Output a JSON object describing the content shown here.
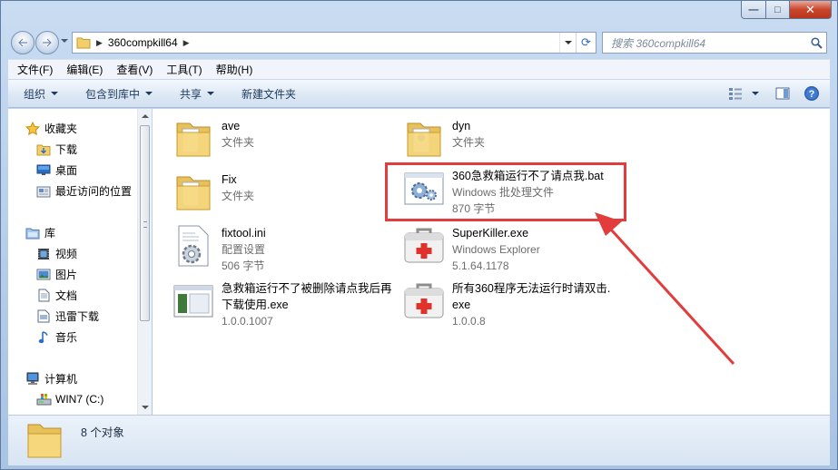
{
  "window": {
    "caption_buttons": {
      "minimize": "—",
      "maximize": "□",
      "close": "✕"
    }
  },
  "address": {
    "path_segment": "360compkill64",
    "search_placeholder": "搜索 360compkill64"
  },
  "menubar": {
    "items": [
      "文件(F)",
      "编辑(E)",
      "查看(V)",
      "工具(T)",
      "帮助(H)"
    ]
  },
  "toolbar": {
    "organize": "组织",
    "include_in_library": "包含到库中",
    "share": "共享",
    "new_folder": "新建文件夹"
  },
  "sidebar": {
    "favorites": {
      "label": "收藏夹",
      "items": [
        "下载",
        "桌面",
        "最近访问的位置"
      ]
    },
    "libraries": {
      "label": "库",
      "items": [
        "视频",
        "图片",
        "文档",
        "迅雷下载",
        "音乐"
      ]
    },
    "computer": {
      "label": "计算机",
      "items": [
        "WIN7 (C:)"
      ]
    }
  },
  "files": [
    {
      "name": "ave",
      "line2": "文件夹",
      "line3": "",
      "icon": "folder-icon"
    },
    {
      "name": "dyn",
      "line2": "文件夹",
      "line3": "",
      "icon": "folder-icon"
    },
    {
      "name": "Fix",
      "line2": "文件夹",
      "line3": "",
      "icon": "folder-icon"
    },
    {
      "name": "360急救箱运行不了请点我.bat",
      "line2": "Windows 批处理文件",
      "line3": "870 字节",
      "icon": "batch-file-gears-icon"
    },
    {
      "name": "fixtool.ini",
      "line2": "配置设置",
      "line3": "506 字节",
      "icon": "ini-settings-icon"
    },
    {
      "name": "SuperKiller.exe",
      "line2": "Windows Explorer",
      "line3": "5.1.64.1178",
      "icon": "first-aid-kit-icon"
    },
    {
      "name": "急救箱运行不了被删除请点我后再",
      "name2": "下载使用.exe",
      "line2": "1.0.0.1007",
      "icon": "app-window-icon"
    },
    {
      "name": "所有360程序无法运行时请双击.",
      "name2": "exe",
      "line2": "1.0.0.8",
      "icon": "first-aid-kit-icon"
    }
  ],
  "status": {
    "count": "8 个对象"
  },
  "colors": {
    "highlight": "#e23c3c",
    "accent": "#2d6bc4"
  }
}
